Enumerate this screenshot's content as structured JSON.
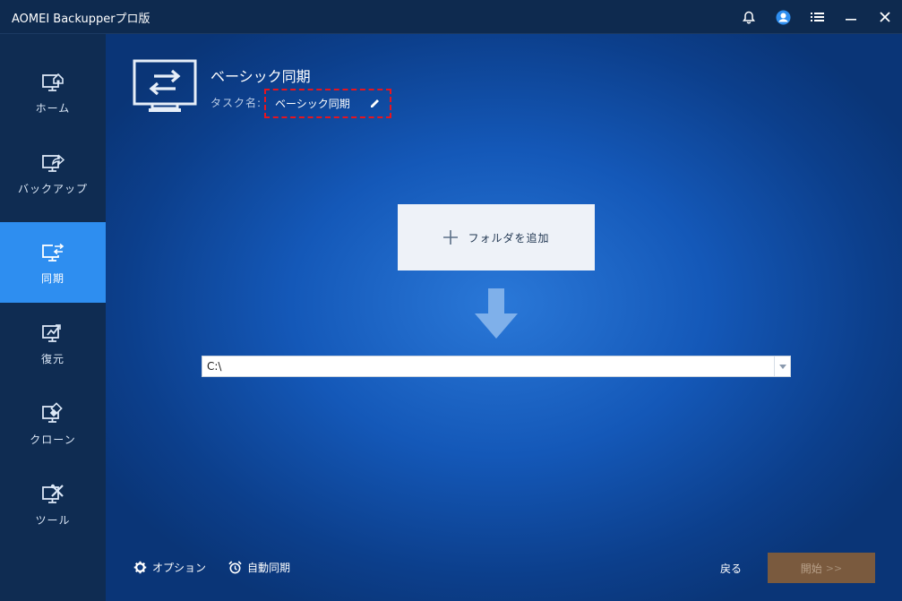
{
  "window": {
    "title": "AOMEI Backupperプロ版",
    "icons": [
      "bell-icon",
      "user-icon",
      "menu-icon",
      "minimize-icon",
      "close-icon"
    ]
  },
  "sidebar": {
    "items": [
      {
        "label": "ホーム",
        "icon": "home-icon",
        "active": false
      },
      {
        "label": "バックアップ",
        "icon": "backup-icon",
        "active": false
      },
      {
        "label": "同期",
        "icon": "sync-icon",
        "active": true
      },
      {
        "label": "復元",
        "icon": "restore-icon",
        "active": false
      },
      {
        "label": "クローン",
        "icon": "clone-icon",
        "active": false
      },
      {
        "label": "ツール",
        "icon": "tools-icon",
        "active": false
      }
    ]
  },
  "task": {
    "title": "ベーシック同期",
    "name_label": "タスク名:",
    "name_value": "ベーシック同期"
  },
  "source": {
    "add_folder_label": "フォルダを追加"
  },
  "destination": {
    "value": "C:\\"
  },
  "footer": {
    "options_label": "オプション",
    "auto_sync_label": "自動同期",
    "back_label": "戻る",
    "start_label": "開始",
    "start_chevron": ">>"
  },
  "colors": {
    "accent": "#2e8ef0",
    "highlight_dashed": "#e8141e",
    "start_button": "#7a5a3e"
  }
}
